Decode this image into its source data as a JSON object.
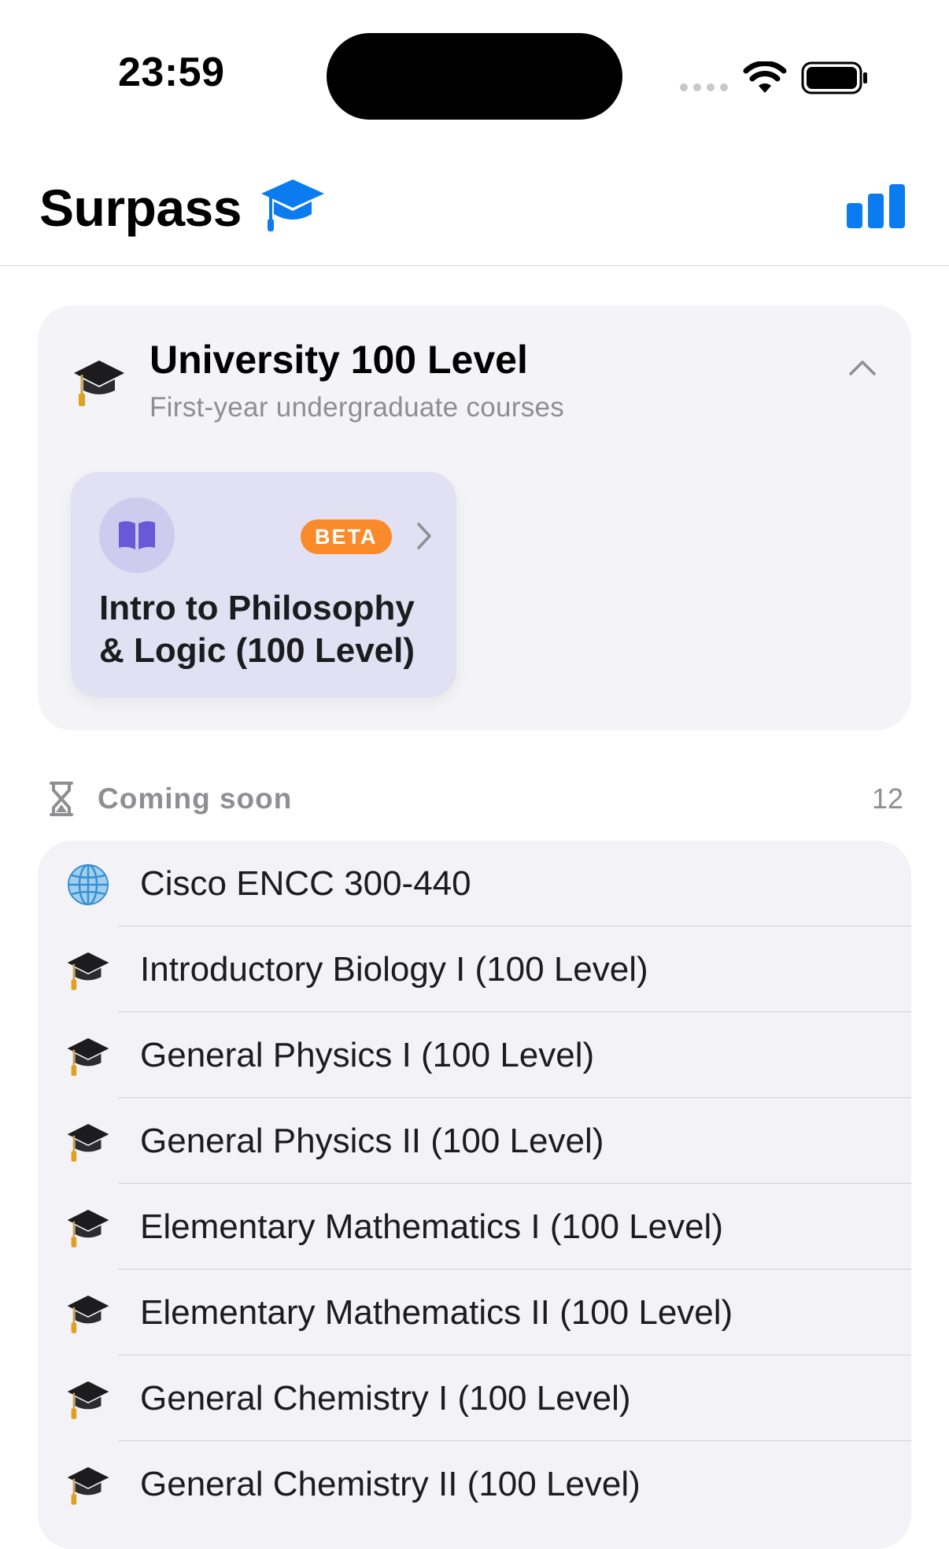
{
  "status_bar": {
    "time": "23:59"
  },
  "header": {
    "title": "Surpass",
    "accent_color": "#0a7cf0",
    "title_icon": "graduation-cap-icon",
    "action_icon": "bar-chart-icon"
  },
  "level": {
    "title": "University 100 Level",
    "subtitle": "First-year undergraduate courses",
    "emoji": "graduation-cap-emoji"
  },
  "featured_course": {
    "badge": "BETA",
    "name": "Intro to Philosophy & Logic (100 Level)",
    "icon": "book-icon",
    "badge_color": "#fb8a2b"
  },
  "coming_soon": {
    "label": "Coming soon",
    "count": "12",
    "items": [
      {
        "label": "Cisco ENCC 300-440",
        "icon": "globe-icon"
      },
      {
        "label": "Introductory Biology I (100 Level)",
        "icon": "graduation-cap-icon"
      },
      {
        "label": "General Physics I (100 Level)",
        "icon": "graduation-cap-icon"
      },
      {
        "label": "General Physics II (100 Level)",
        "icon": "graduation-cap-icon"
      },
      {
        "label": "Elementary Mathematics I (100 Level)",
        "icon": "graduation-cap-icon"
      },
      {
        "label": "Elementary Mathematics II (100 Level)",
        "icon": "graduation-cap-icon"
      },
      {
        "label": "General Chemistry I (100 Level)",
        "icon": "graduation-cap-icon"
      },
      {
        "label": "General Chemistry II (100 Level)",
        "icon": "graduation-cap-icon"
      }
    ]
  }
}
